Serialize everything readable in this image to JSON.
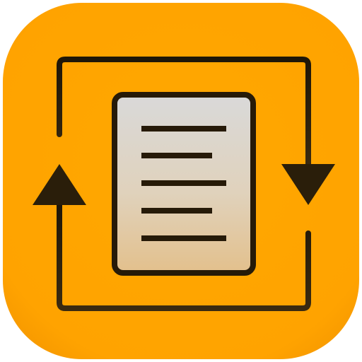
{
  "app_icon": {
    "icon_name": "document-sync-icon",
    "document_icon_name": "document-lines-icon",
    "cycle_arrows_icon_name": "cycle-arrows-icon",
    "colors": {
      "tile_orange": "#FFA500",
      "tile_edge_orange": "#F59A00",
      "stroke_dark": "#261A08",
      "document_top": "#D8D8D8",
      "document_bottom": "#E2C290"
    }
  }
}
